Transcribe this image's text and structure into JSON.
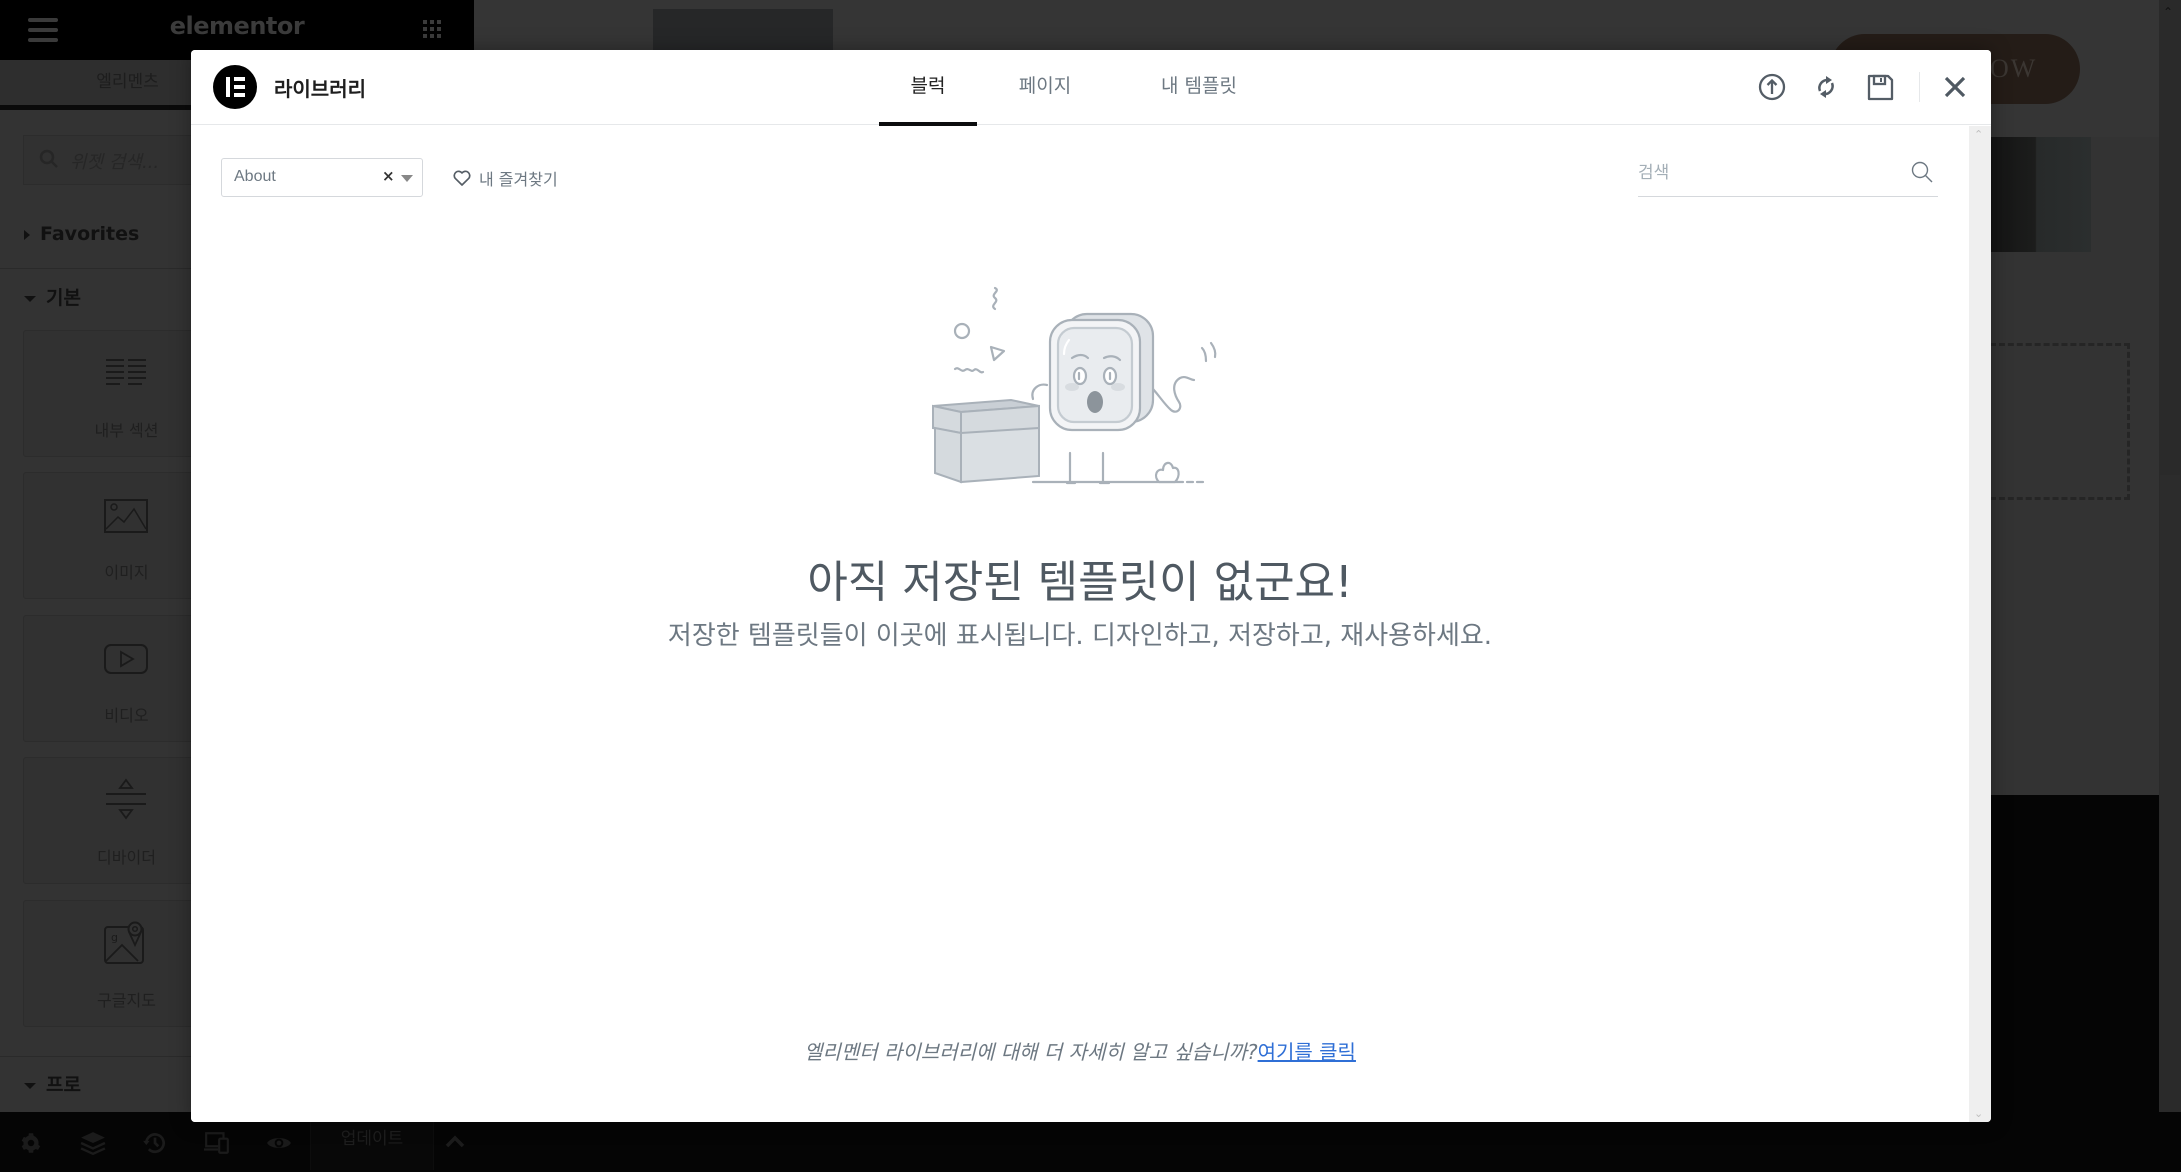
{
  "editor": {
    "logo": "elementor",
    "tabs": [
      {
        "label": "엘리멘츠"
      }
    ],
    "search_placeholder": "위젯 검색...",
    "categories": [
      {
        "label": "Favorites",
        "expanded": false
      },
      {
        "label": "기본",
        "expanded": true
      },
      {
        "label": "프로",
        "expanded": true
      }
    ],
    "widgets": [
      {
        "label": "내부 섹션",
        "icon": "inner-section-icon"
      },
      {
        "label": "이미지",
        "icon": "image-icon"
      },
      {
        "label": "비디오",
        "icon": "video-icon"
      },
      {
        "label": "디바이더",
        "icon": "divider-icon"
      },
      {
        "label": "구글지도",
        "icon": "google-maps-icon"
      }
    ],
    "footer": {
      "icons": [
        "gear-icon",
        "layers-icon",
        "history-icon",
        "responsive-icon",
        "eye-icon"
      ],
      "update_label": "업데이트",
      "more_icon": "chevron-up-icon"
    }
  },
  "canvas": {
    "header_button_visible_text": "OW"
  },
  "library": {
    "title": "라이브러리",
    "tabs": [
      {
        "label": "블럭",
        "active": true
      },
      {
        "label": "페이지",
        "active": false
      },
      {
        "label": "내 템플릿",
        "active": false
      }
    ],
    "header_icons": [
      "upload-icon",
      "sync-icon",
      "save-icon",
      "close-icon"
    ],
    "filter": {
      "selected": "About",
      "clear_label": "×"
    },
    "favorites_label": "내 즐겨찾기",
    "search": {
      "placeholder": "검색",
      "value": ""
    },
    "empty_state": {
      "title": "아직 저장된 템플릿이 없군요!",
      "message": "저장한 템플릿들이 이곳에 표시됩니다. 디자인하고, 저장하고, 재사용하세요."
    },
    "footer_note": {
      "text": "엘리멘터 라이브러리에 대해 더 자세히 알고 싶습니까?",
      "link_label": "여기를 클릭"
    },
    "colors": {
      "accent": "#0c0d0e",
      "link": "#2f6fd6",
      "text_muted": "#6d7882"
    }
  }
}
